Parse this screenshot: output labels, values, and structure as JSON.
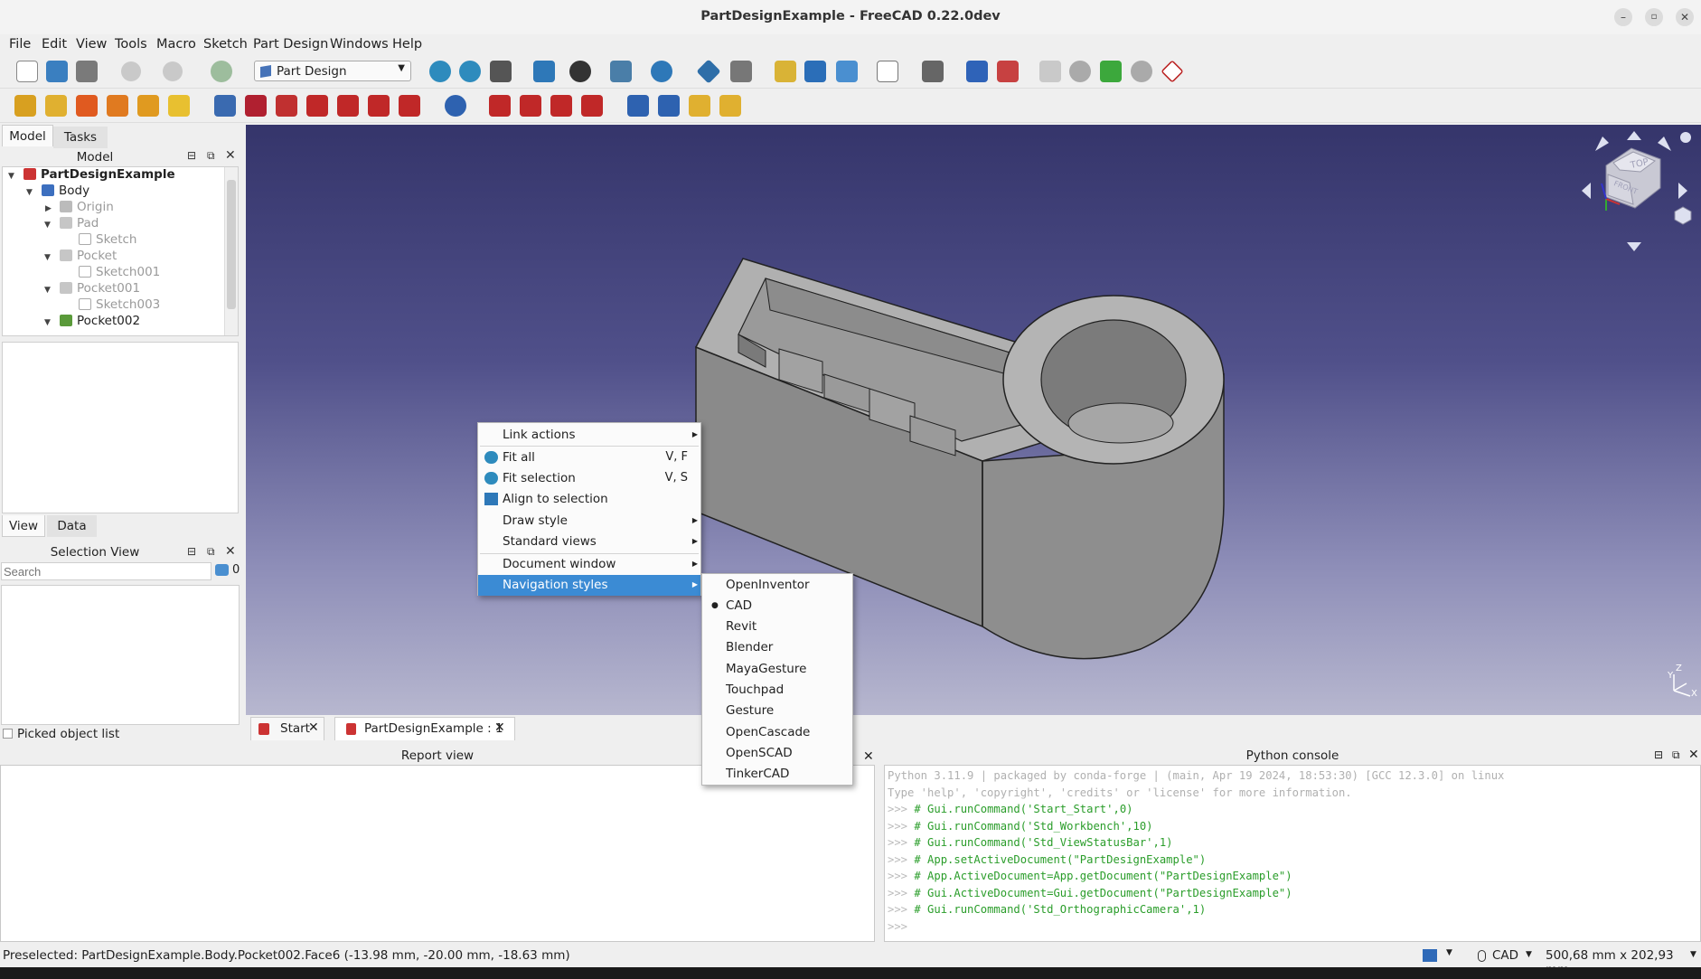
{
  "window": {
    "title": "PartDesignExample - FreeCAD 0.22.0dev"
  },
  "menubar": [
    "File",
    "Edit",
    "View",
    "Tools",
    "Macro",
    "Sketch",
    "Part Design",
    "Windows",
    "Help"
  ],
  "toolbar": {
    "workbench": "Part Design"
  },
  "left_panel": {
    "tabs": [
      "Model",
      "Tasks"
    ],
    "tree_header": "Model",
    "tree": [
      {
        "label": "PartDesignExample",
        "bold": true
      },
      {
        "label": "Body"
      },
      {
        "label": "Origin",
        "dim": true
      },
      {
        "label": "Pad",
        "dim": true
      },
      {
        "label": "Sketch",
        "dim": true
      },
      {
        "label": "Pocket",
        "dim": true
      },
      {
        "label": "Sketch001",
        "dim": true
      },
      {
        "label": "Pocket001",
        "dim": true
      },
      {
        "label": "Sketch003",
        "dim": true
      },
      {
        "label": "Pocket002"
      }
    ],
    "prop_tabs": [
      "View",
      "Data"
    ],
    "selection_header": "Selection View",
    "search_placeholder": "Search",
    "selection_count": "0",
    "picked_label": "Picked object list"
  },
  "doc_tabs": [
    "Start",
    "PartDesignExample : 1"
  ],
  "context_menu": {
    "items": [
      {
        "label": "Link actions",
        "submenu": true
      },
      {
        "label": "Fit all",
        "shortcut": "V, F",
        "icon": "zoom-icon"
      },
      {
        "label": "Fit selection",
        "shortcut": "V, S",
        "icon": "zoom-icon"
      },
      {
        "label": "Align to selection",
        "icon": "align-icon"
      },
      {
        "label": "Draw style",
        "submenu": true
      },
      {
        "label": "Standard views",
        "submenu": true
      },
      {
        "label": "Document window",
        "submenu": true
      },
      {
        "label": "Navigation styles",
        "submenu": true,
        "highlighted": true
      }
    ]
  },
  "nav_styles_menu": {
    "items": [
      "OpenInventor",
      "CAD",
      "Revit",
      "Blender",
      "MayaGesture",
      "Touchpad",
      "Gesture",
      "OpenCascade",
      "OpenSCAD",
      "TinkerCAD"
    ],
    "selected": "CAD"
  },
  "report_view": {
    "title": "Report view"
  },
  "python_console": {
    "title": "Python console",
    "lines": [
      {
        "text": "Python 3.11.9 | packaged by conda-forge | (main, Apr 19 2024, 18:53:30) [GCC 12.3.0] on linux",
        "kind": "info"
      },
      {
        "text": "Type 'help', 'copyright', 'credits' or 'license' for more information.",
        "kind": "info"
      },
      {
        "text": "# Gui.runCommand('Start_Start',0)",
        "kind": "cmd"
      },
      {
        "text": "# Gui.runCommand('Std_Workbench',10)",
        "kind": "cmd"
      },
      {
        "text": "# Gui.runCommand('Std_ViewStatusBar',1)",
        "kind": "cmd"
      },
      {
        "text": "# App.setActiveDocument(\"PartDesignExample\")",
        "kind": "cmd"
      },
      {
        "text": "# App.ActiveDocument=App.getDocument(\"PartDesignExample\")",
        "kind": "cmd"
      },
      {
        "text": "# Gui.ActiveDocument=Gui.getDocument(\"PartDesignExample\")",
        "kind": "cmd"
      },
      {
        "text": "# Gui.runCommand('Std_OrthographicCamera',1)",
        "kind": "cmd"
      },
      {
        "text": "",
        "kind": "prompt"
      }
    ],
    "prompt": ">>>"
  },
  "navcube": {
    "top": "TOP",
    "front": "FRONT"
  },
  "axis": {
    "z": "Z",
    "y": "Y",
    "x": "X"
  },
  "statusbar": {
    "message": "Preselected: PartDesignExample.Body.Pocket002.Face6 (-13.98 mm, -20.00 mm, -18.63 mm)",
    "nav_style": "CAD",
    "dimensions": "500,68 mm x 202,93 mm"
  }
}
